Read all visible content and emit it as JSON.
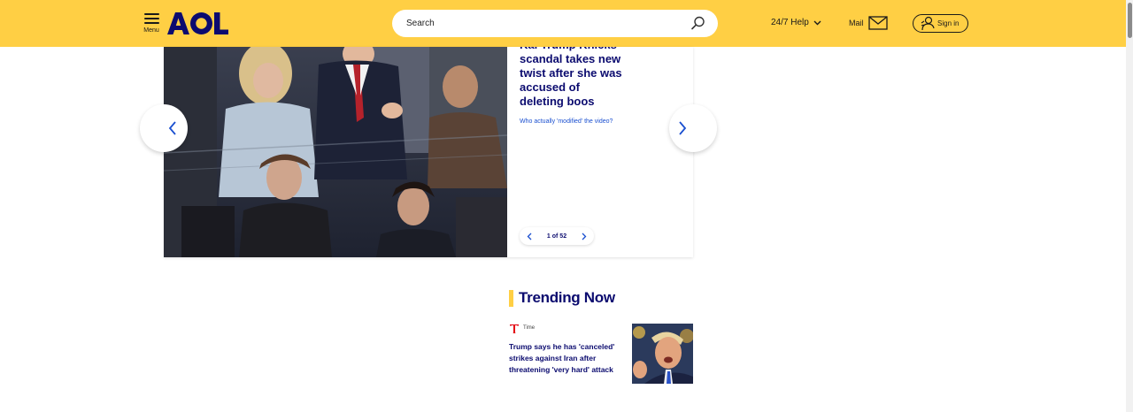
{
  "header": {
    "menu_label": "Menu",
    "logo_text": "AOL",
    "search_placeholder": "Search",
    "help_label": "24/7 Help",
    "mail_label": "Mail",
    "signin_label": "Sign in",
    "bg_color": "#ffcf44"
  },
  "carousel": {
    "headline": "Kai Trump Knicks scandal takes new twist after she was accused of deleting boos",
    "subhead": "Who actually 'modified' the video?",
    "pager": "1 of 52"
  },
  "trending": {
    "title": "Trending Now",
    "stories": [
      {
        "source": "Time",
        "title": "Trump says he has 'canceled' strikes against Iran after threatening 'very hard' attack"
      }
    ]
  },
  "colors": {
    "accent": "#ffcf44",
    "headline": "#0b0b6f",
    "link": "#1a4fd0"
  }
}
